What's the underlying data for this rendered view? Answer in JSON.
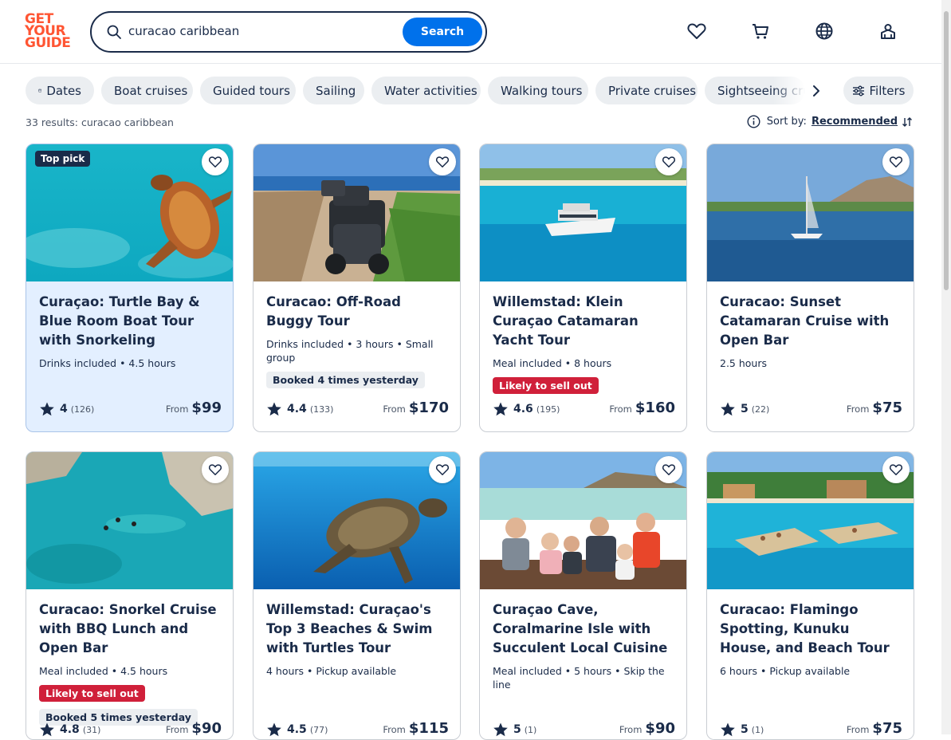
{
  "brand": {
    "line1": "GET",
    "line2": "YOUR",
    "line3": "GUIDE",
    "color": "#ff5533"
  },
  "search": {
    "value": "curacao caribbean",
    "button": "Search"
  },
  "header_icons": [
    "heart-icon",
    "cart-icon",
    "globe-icon",
    "account-icon"
  ],
  "chips": [
    "Dates",
    "Boat cruises",
    "Guided tours",
    "Sailing",
    "Water activities",
    "Walking tours",
    "Private cruises",
    "Sightseeing cru"
  ],
  "filters_label": "Filters",
  "results_text": "33 results: curacao caribbean",
  "sort": {
    "label": "Sort by:",
    "value": "Recommended"
  },
  "accent": "#0071eb",
  "cards": [
    {
      "title": "Curaçao: Turtle Bay & Blue Room Boat Tour with Snorkeling",
      "meta": "Drinks included • 4.5 hours",
      "top_pick": "Top pick",
      "rating": "4",
      "reviews": "(126)",
      "from": "From",
      "price": "$99"
    },
    {
      "title": "Curacao: Off-Road Buggy Tour",
      "meta": "Drinks included • 3 hours • Small group",
      "grey_tag": "Booked 4 times yesterday",
      "rating": "4.4",
      "reviews": "(133)",
      "from": "From",
      "price": "$170"
    },
    {
      "title": "Willemstad: Klein Curaçao Catamaran Yacht Tour",
      "meta": "Meal included • 8 hours",
      "red_tag": "Likely to sell out",
      "rating": "4.6",
      "reviews": "(195)",
      "from": "From",
      "price": "$160"
    },
    {
      "title": "Curacao: Sunset Catamaran Cruise with Open Bar",
      "meta": "2.5 hours",
      "rating": "5",
      "reviews": "(22)",
      "from": "From",
      "price": "$75"
    },
    {
      "title": "Curacao: Snorkel Cruise with BBQ Lunch and Open Bar",
      "meta": "Meal included • 4.5 hours",
      "red_tag": "Likely to sell out",
      "grey_tag": "Booked 5 times yesterday",
      "rating": "4.8",
      "reviews": "(31)",
      "from": "From",
      "price": "$90"
    },
    {
      "title": "Willemstad: Curaçao's Top 3 Beaches & Swim with Turtles Tour",
      "meta": "4 hours • Pickup available",
      "rating": "4.5",
      "reviews": "(77)",
      "from": "From",
      "price": "$115"
    },
    {
      "title": "Curaçao Cave, Coralmarine Isle with Succulent Local Cuisine",
      "meta": "Meal included • 5 hours • Skip the line",
      "rating": "5",
      "reviews": "(1)",
      "from": "From",
      "price": "$90"
    },
    {
      "title": "Curacao: Flamingo Spotting, Kunuku House, and Beach Tour",
      "meta": "6 hours • Pickup available",
      "rating": "5",
      "reviews": "(1)",
      "from": "From",
      "price": "$75"
    }
  ]
}
